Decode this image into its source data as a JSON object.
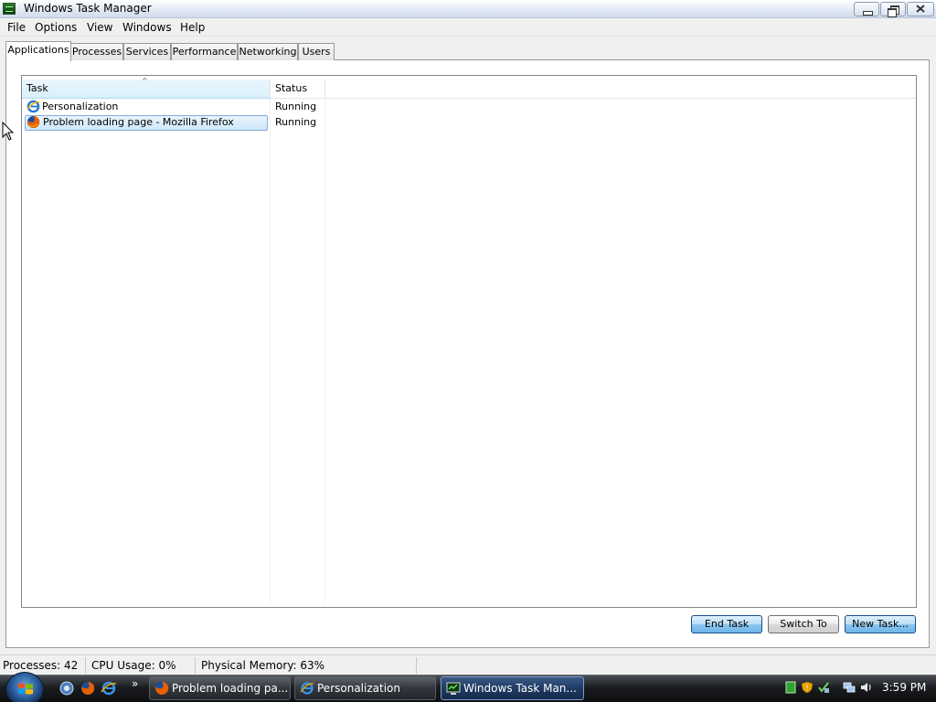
{
  "window": {
    "title": "Windows Task Manager"
  },
  "menu": [
    "File",
    "Options",
    "View",
    "Windows",
    "Help"
  ],
  "tabs": [
    {
      "label": "Applications",
      "active": true
    },
    {
      "label": "Processes",
      "active": false
    },
    {
      "label": "Services",
      "active": false
    },
    {
      "label": "Performance",
      "active": false
    },
    {
      "label": "Networking",
      "active": false
    },
    {
      "label": "Users",
      "active": false
    }
  ],
  "list": {
    "columns": [
      "Task",
      "Status"
    ],
    "sort_indicator": "^",
    "rows": [
      {
        "task": "Personalization",
        "status": "Running",
        "icon": "internet-explorer-icon",
        "selected": false
      },
      {
        "task": "Problem loading page - Mozilla Firefox",
        "status": "Running",
        "icon": "firefox-icon",
        "selected": true
      }
    ]
  },
  "buttons": {
    "end_task": "End Task",
    "switch_to": "Switch To",
    "new_task": "New Task..."
  },
  "statusbar": {
    "processes": "Processes: 42",
    "cpu": "CPU Usage: 0%",
    "memory": "Physical Memory: 63%"
  },
  "taskbar": {
    "overflow": "»",
    "items": [
      {
        "label": "Problem loading pa...",
        "icon": "firefox-icon",
        "active": false
      },
      {
        "label": "Personalization",
        "icon": "internet-explorer-icon",
        "active": false
      },
      {
        "label": "Windows Task Man...",
        "icon": "task-manager-icon",
        "active": true
      }
    ],
    "clock": "3:59 PM"
  },
  "colors": {
    "selection": "#cee8fb",
    "accent": "#3c7fb1",
    "taskbar": "#1a1c1f"
  }
}
